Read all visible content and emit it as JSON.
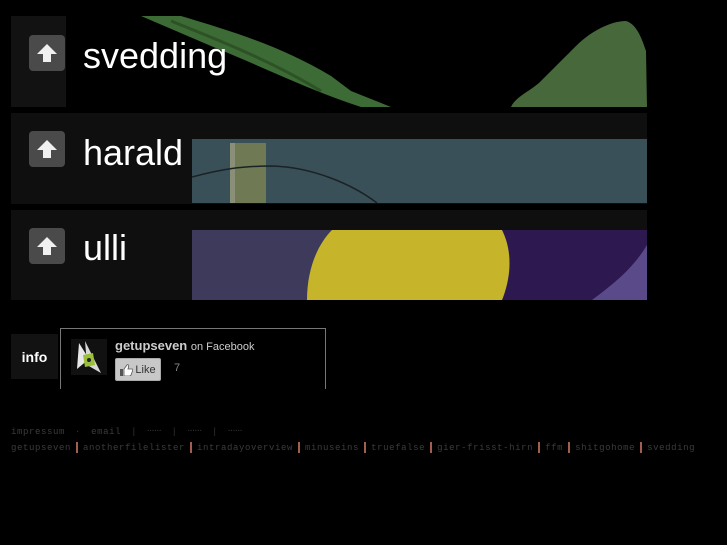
{
  "rows": [
    {
      "label": "svedding",
      "up_icon": "arrow-up-icon",
      "image": "green-leaf-photo"
    },
    {
      "label": "harald",
      "up_icon": "arrow-up-icon",
      "image": "fence-post-wire-photo"
    },
    {
      "label": "ulli",
      "up_icon": "arrow-up-icon",
      "image": "yellow-purple-flower-photo"
    }
  ],
  "info": {
    "tab_label": "info",
    "facebook": {
      "page_name": "getupseven",
      "on_text": "on Facebook",
      "like_label": "Like",
      "like_count": "7"
    }
  },
  "footer": {
    "line1": {
      "impressum": "impressum",
      "dot": "·",
      "email": "email",
      "sep": "|",
      "tiny_links": [
        "▪▪▪▪▪▪",
        "▪▪▪▪▪▪",
        "▪▪▪▪▪▪"
      ]
    },
    "links": [
      "getupseven",
      "anotherfilelister",
      "intradayoverview",
      "minuseins",
      "truefalse",
      "gier-frisst-hirn",
      "ffm",
      "shitgohome",
      "svedding"
    ]
  },
  "colors": {
    "background": "#000000",
    "row_bg": "#0f0f0f",
    "button_bg": "#4a4a4a",
    "separator": "#a06050"
  }
}
